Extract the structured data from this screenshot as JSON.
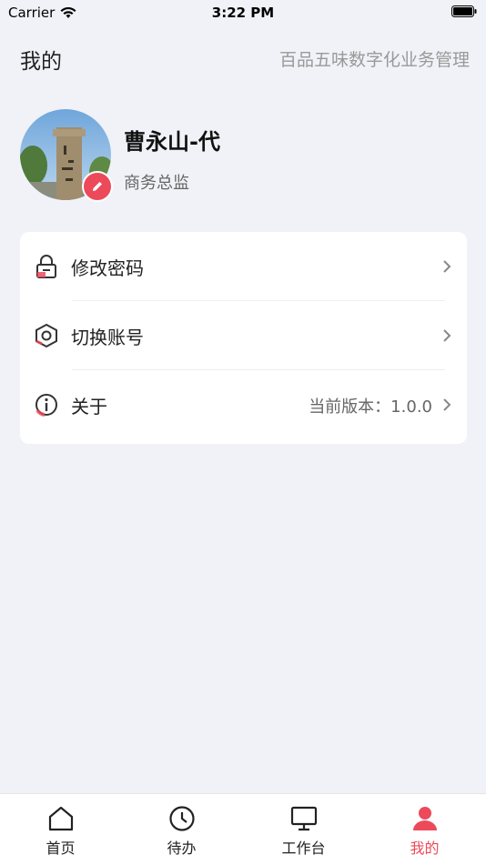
{
  "status_bar": {
    "carrier": "Carrier",
    "time": "3:22 PM"
  },
  "header": {
    "title": "我的",
    "subtitle": "百品五味数字化业务管理"
  },
  "profile": {
    "name": "曹永山-代",
    "role": "商务总监"
  },
  "menu": {
    "items": [
      {
        "label": "修改密码",
        "icon": "lock-icon"
      },
      {
        "label": "切换账号",
        "icon": "switch-account-icon"
      },
      {
        "label": "关于",
        "value": "当前版本：1.0.0",
        "icon": "info-icon"
      }
    ]
  },
  "tabbar": {
    "items": [
      {
        "label": "首页",
        "icon": "home-icon"
      },
      {
        "label": "待办",
        "icon": "clock-icon"
      },
      {
        "label": "工作台",
        "icon": "monitor-icon"
      },
      {
        "label": "我的",
        "icon": "user-icon",
        "active": true
      }
    ]
  },
  "colors": {
    "accent": "#ec4a5a",
    "background": "#f1f2f7"
  }
}
